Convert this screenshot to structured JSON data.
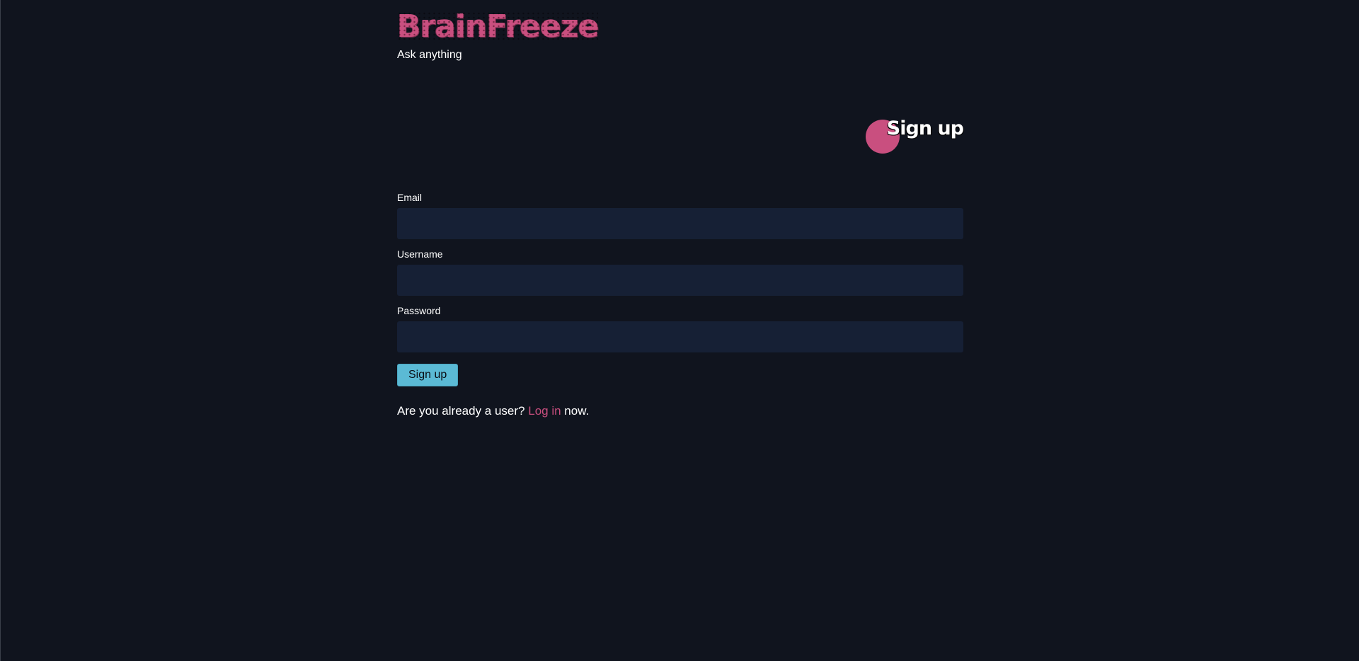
{
  "header": {
    "brand": "BrainFreeze",
    "tagline": "Ask anything"
  },
  "page": {
    "title": "Sign up"
  },
  "form": {
    "email_label": "Email",
    "email_value": "",
    "username_label": "Username",
    "username_value": "",
    "password_label": "Password",
    "password_value": "",
    "submit_label": "Sign up"
  },
  "footer": {
    "prompt_before": "Are you already a user?",
    "login_link": "Log in",
    "prompt_after": "now."
  },
  "colors": {
    "background": "#10141e",
    "brand_pink": "#c94f7f",
    "input_bg": "#162035",
    "button_blue": "#5bbad5"
  }
}
